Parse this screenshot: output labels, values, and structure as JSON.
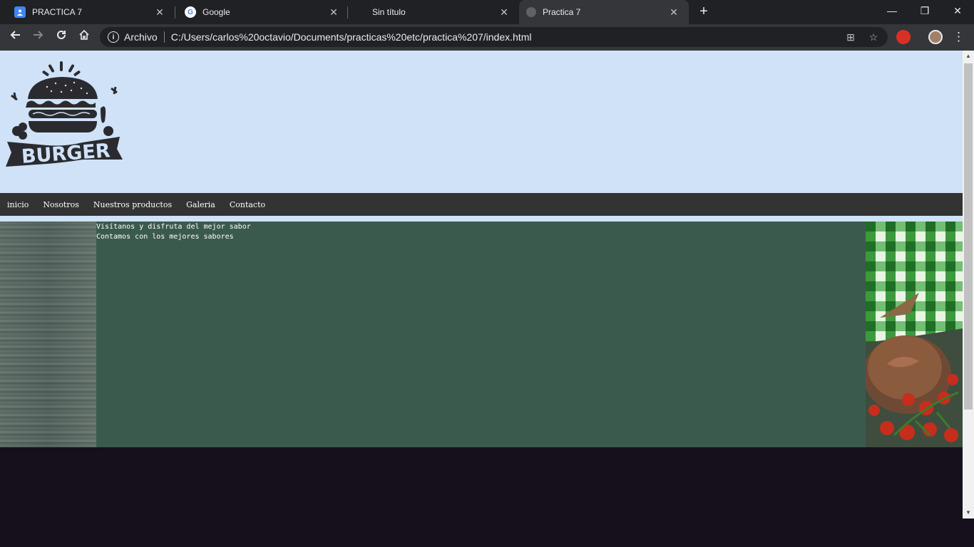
{
  "browser": {
    "tabs": [
      {
        "title": "PRACTICA 7",
        "icon": "slides-icon"
      },
      {
        "title": "Google",
        "icon": "google-icon"
      },
      {
        "title": "Sin título",
        "icon": "none"
      },
      {
        "title": "Practica 7",
        "icon": "globe-icon",
        "active": true
      }
    ],
    "address": {
      "chip": "Archivo",
      "url": "C:/Users/carlos%20octavio/Documents/practicas%20etc/practica%207/index.html"
    }
  },
  "site": {
    "logo_text": "BURGER",
    "nav": [
      "inicio",
      "Nosotros",
      "Nuestros productos",
      "Galeria",
      "Contacto"
    ],
    "content_lines": [
      "Visítanos y disfruta del mejor sabor",
      "Contamos con los mejores sabores"
    ]
  },
  "colors": {
    "header_bg": "#cfe2f8",
    "nav_bg": "#333333",
    "main_bg": "#3b5a4e",
    "page_bg": "#15101c"
  }
}
